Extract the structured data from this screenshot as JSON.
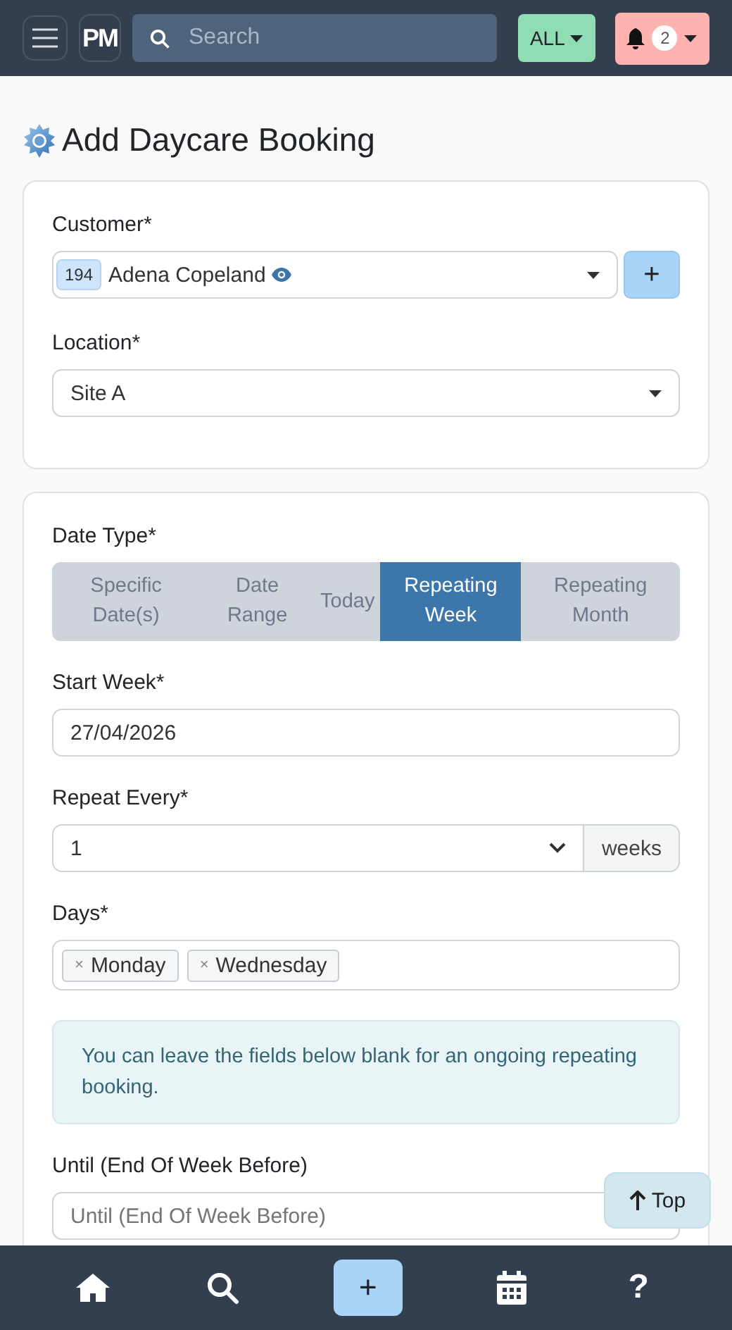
{
  "header": {
    "logo": "PM",
    "search": {
      "placeholder": "Search"
    },
    "filter": "ALL",
    "notifications": "2"
  },
  "title": "Add Daycare Booking",
  "customer_card": {
    "customer": {
      "label": "Customer*",
      "id": "194",
      "name": "Adena Copeland",
      "add": "+"
    },
    "location": {
      "label": "Location*",
      "value": "Site A"
    }
  },
  "booking_card": {
    "date_type": {
      "label": "Date Type*",
      "options": [
        {
          "label": "Specific Date(s)",
          "selected": false
        },
        {
          "label": "Date Range",
          "selected": false
        },
        {
          "label": "Today",
          "selected": false
        },
        {
          "label": "Repeating Week",
          "selected": true
        },
        {
          "label": "Repeating Month",
          "selected": false
        }
      ]
    },
    "start_week": {
      "label": "Start Week*",
      "value": "27/04/2026"
    },
    "repeat_every": {
      "label": "Repeat Every*",
      "value": "1",
      "unit": "weeks"
    },
    "days": {
      "label": "Days*",
      "tags": [
        {
          "remove": "×",
          "label": "Monday"
        },
        {
          "remove": "×",
          "label": "Wednesday"
        }
      ]
    },
    "info": "You can leave the fields below blank for an ongoing repeating booking.",
    "until": {
      "label": "Until (End Of Week Before)",
      "placeholder": "Until (End Of Week Before)"
    }
  },
  "top_button": "Top",
  "bottom_nav": [
    {
      "kind": "home"
    },
    {
      "kind": "search"
    },
    {
      "kind": "add",
      "label": "+"
    },
    {
      "kind": "calendar"
    },
    {
      "kind": "help",
      "label": "?"
    }
  ]
}
